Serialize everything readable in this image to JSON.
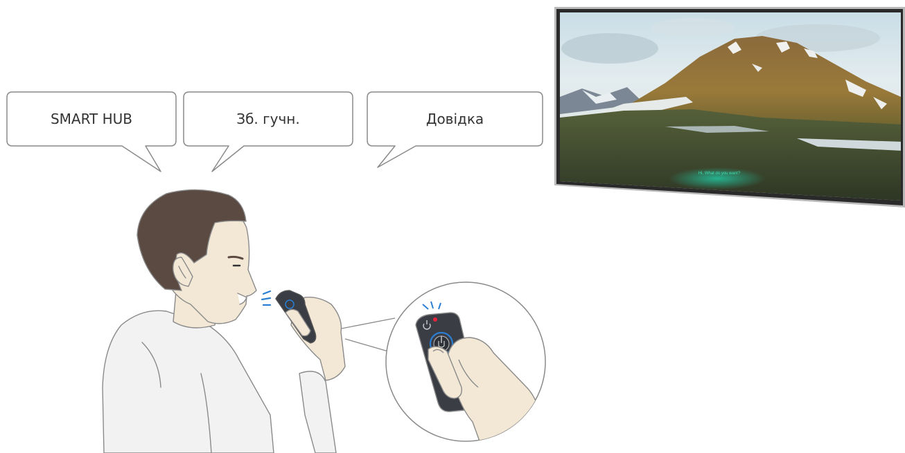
{
  "speech_bubbles": [
    {
      "label": "SMART HUB"
    },
    {
      "label": "Зб. гучн."
    },
    {
      "label": "Довідка"
    }
  ],
  "tv_screen": {
    "caption": "Hi, What do you want?",
    "caption_color": "#3fe0b8"
  },
  "remote": {
    "indicator_color": "#e8243c",
    "mic_glow_color": "#2a7fd4",
    "sound_wave_color": "#2a7fd4"
  },
  "colors": {
    "outline": "#8a8a8a",
    "hair": "#5a4a42",
    "skin": "#f3e8d6",
    "shirt": "#f2f2f2",
    "remote_body": "#3a3d44"
  }
}
